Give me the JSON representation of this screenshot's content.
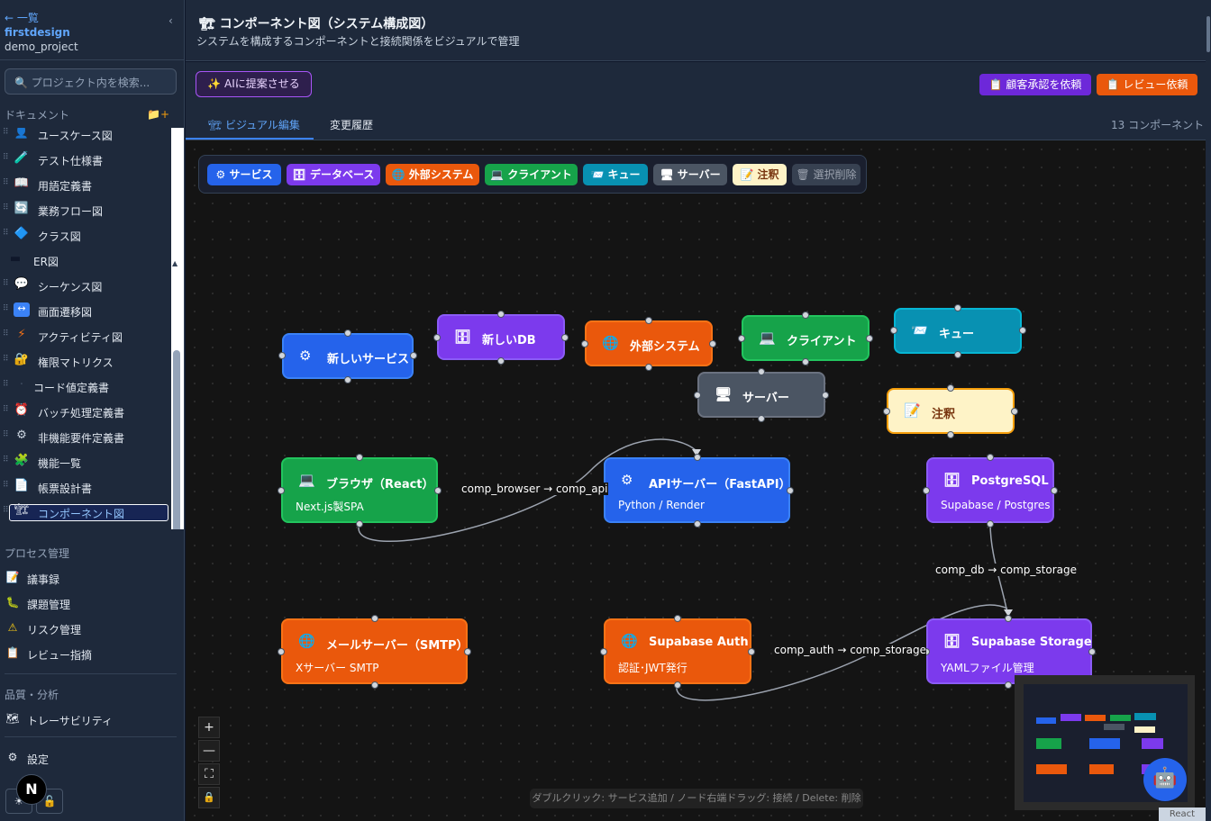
{
  "sidebar": {
    "back": "← 一覧",
    "collapse": "‹",
    "project_name": "firstdesign",
    "project_id": "demo_project",
    "search_placeholder": "🔍 プロジェクト内を検索...",
    "documents_title": "ドキュメント",
    "add_icon": "📁+",
    "docs": [
      {
        "icon": "👤",
        "label": "ユースケース図"
      },
      {
        "icon": "🧪",
        "label": "テスト仕様書"
      },
      {
        "icon": "📖",
        "label": "用語定義書"
      },
      {
        "icon": "🔄",
        "label": "業務フロー図"
      },
      {
        "icon": "🔷",
        "label": "クラス図"
      },
      {
        "icon": "▬",
        "label": "ER図"
      },
      {
        "icon": "💬",
        "label": "シーケンス図"
      },
      {
        "icon": "↔",
        "label": "画面遷移図"
      },
      {
        "icon": "⚡",
        "label": "アクティビティ図"
      },
      {
        "icon": "🔐",
        "label": "権限マトリクス"
      },
      {
        "icon": "·",
        "label": "コード値定義書"
      },
      {
        "icon": "⏰",
        "label": "バッチ処理定義書"
      },
      {
        "icon": "⚙",
        "label": "非機能要件定義書"
      },
      {
        "icon": "🧩",
        "label": "機能一覧"
      },
      {
        "icon": "📄",
        "label": "帳票設計書"
      },
      {
        "icon": "🏗",
        "label": "コンポーネント図"
      }
    ],
    "process_title": "プロセス管理",
    "process": [
      {
        "icon": "📝",
        "label": "議事録"
      },
      {
        "icon": "🐛",
        "label": "課題管理"
      },
      {
        "icon": "⚠",
        "label": "リスク管理"
      },
      {
        "icon": "📋",
        "label": "レビュー指摘"
      }
    ],
    "quality_title": "品質・分析",
    "quality": [
      {
        "icon": "🗺",
        "label": "トレーサビリティ"
      }
    ],
    "settings": {
      "icon": "⚙",
      "label": "設定"
    },
    "n_badge": "N",
    "bottom_buttons": [
      "☀",
      "🔓"
    ]
  },
  "header": {
    "icon": "🏗",
    "title": "コンポーネント図（システム構成図）",
    "subtitle": "システムを構成するコンポーネントと接続関係をビジュアルで管理"
  },
  "toolbar": {
    "ai_button": "✨ AIに提案させる",
    "approval_button": "📋 顧客承認を依頼",
    "review_button": "📋 レビュー依頼"
  },
  "tabs": {
    "visual": "🏗 ビジュアル編集",
    "history": "変更履歴",
    "count": "13 コンポーネント"
  },
  "palette": [
    {
      "label": "⚙ サービス",
      "color": "#2563eb"
    },
    {
      "label": "🗄 データベース",
      "color": "#7c3aed"
    },
    {
      "label": "🌐 外部システム",
      "color": "#ea580c"
    },
    {
      "label": "💻 クライアント",
      "color": "#16a34a"
    },
    {
      "label": "📨 キュー",
      "color": "#0891b2"
    },
    {
      "label": "🖥 サーバー",
      "color": "#4b5563"
    },
    {
      "label": "📝 注釈",
      "color": "#fef3c7"
    },
    {
      "label": "🗑 選択削除",
      "color": "#374151"
    }
  ],
  "nodes": [
    {
      "icon": "⚙",
      "title": "新しいサービス",
      "desc": ""
    },
    {
      "icon": "🗄",
      "title": "新しいDB",
      "desc": ""
    },
    {
      "icon": "🌐",
      "title": "外部システム",
      "desc": ""
    },
    {
      "icon": "💻",
      "title": "クライアント",
      "desc": ""
    },
    {
      "icon": "📨",
      "title": "キュー",
      "desc": ""
    },
    {
      "icon": "🖥",
      "title": "サーバー",
      "desc": ""
    },
    {
      "icon": "📝",
      "title": "注釈",
      "desc": ""
    },
    {
      "icon": "💻",
      "title": "ブラウザ（React）",
      "desc": "Next.js製SPA"
    },
    {
      "icon": "⚙",
      "title": "APIサーバー（FastAPI）",
      "desc": "Python / Render"
    },
    {
      "icon": "🗄",
      "title": "PostgreSQL",
      "desc": "Supabase / Postgres"
    },
    {
      "icon": "🌐",
      "title": "メールサーバー（SMTP）",
      "desc": "Xサーバー SMTP"
    },
    {
      "icon": "🌐",
      "title": "Supabase Auth",
      "desc": "認証･JWT発行"
    },
    {
      "icon": "🗄",
      "title": "Supabase Storage",
      "desc": "YAMLファイル管理"
    }
  ],
  "edges": [
    {
      "label": "comp_browser → comp_api"
    },
    {
      "label": "comp_db → comp_storage"
    },
    {
      "label": "comp_auth → comp_storage"
    }
  ],
  "controls": [
    "+",
    "—",
    "⛶",
    "🔒"
  ],
  "hint": "ダブルクリック: サービス追加 / ノード右端ドラッグ: 接続 / Delete: 削除",
  "assistant_icon": "🤖",
  "attribution": "React Flow"
}
